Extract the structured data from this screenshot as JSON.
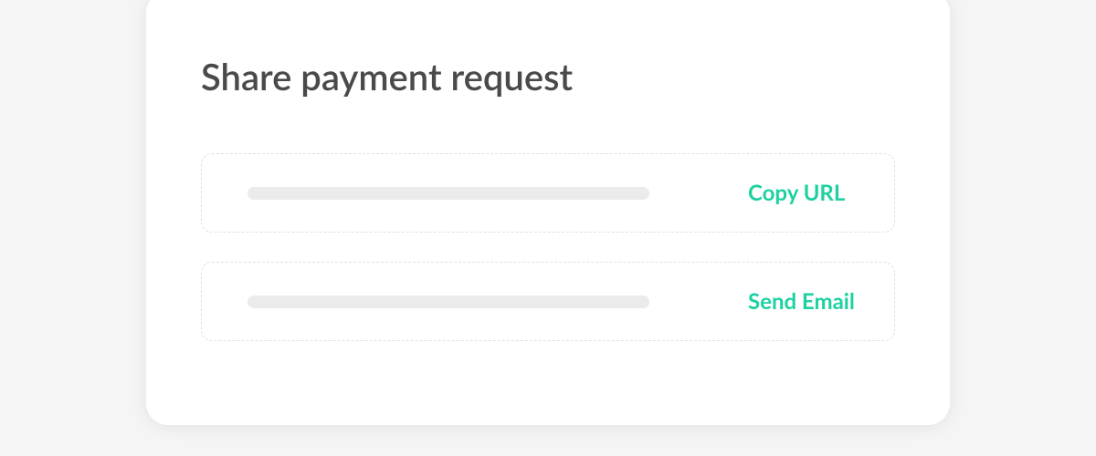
{
  "title": "Share payment request",
  "actions": [
    {
      "label": "Copy URL"
    },
    {
      "label": "Send Email"
    }
  ],
  "colors": {
    "accent": "#1dd1a1"
  }
}
